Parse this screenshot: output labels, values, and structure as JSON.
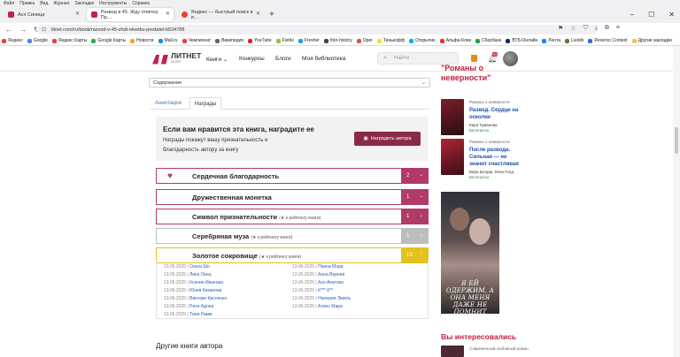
{
  "browser": {
    "menu": [
      "Файл",
      "Правка",
      "Вид",
      "Журнал",
      "Закладки",
      "Инструменты",
      "Справка"
    ],
    "tabs": [
      {
        "label": "Ася Синица",
        "active": false
      },
      {
        "label": "Развод в 45. Жду ответку. Пр…",
        "active": true
      },
      {
        "label": "Яндекс — быстрый поиск в и…",
        "active": false
      }
    ],
    "url": "litnet.com/ru/book/razvod-v-45-zhdi-otvetku-predatel-b534788",
    "bookmarks": [
      "Яндекс",
      "Google",
      "Яндекс Карты",
      "Google Карты",
      "Новости",
      "Mail.ru",
      "Чемпионат",
      "Википедия",
      "YouTube",
      "Fishki",
      "Fresher",
      "foto-history",
      "Oper",
      "Тинькофф",
      "Открытие",
      "Альфа-Клик",
      "Сбербанк",
      "ВТБ-Онлайн",
      "Лента",
      "Livelib",
      "Reverso Context",
      "Другие закладки"
    ]
  },
  "site": {
    "logo": "ЛИТНЕТ",
    "logo_sub": "10 ЛЕТ",
    "nav": [
      "Книги",
      "Конкурсы",
      "Блоги",
      "Моя библиотека"
    ],
    "search_placeholder": "Найти",
    "notifications": "99",
    "contents_select": "Содержание",
    "tabs": [
      "Аннотация",
      "Награды"
    ],
    "award_title": "Если вам нравится эта книга, наградите ее",
    "award_text": "Награды покажут вашу признательность и благодарность автору за книгу",
    "award_button": "Наградить автора",
    "rewards": [
      {
        "name": "Сердечная благодарность",
        "note": "",
        "count": "2",
        "color": "#b23a6a"
      },
      {
        "name": "Дружественная монетка",
        "note": "",
        "count": "1",
        "color": "#b23a6a"
      },
      {
        "name": "Символ признательности",
        "note": "(★ к рейтингу книги)",
        "count": "1",
        "color": "#b23a6a"
      },
      {
        "name": "Серебряная муза",
        "note": "(★ к рейтингу книги)",
        "count": "1",
        "color": "#bdbdbd"
      },
      {
        "name": "Золотое сокровище",
        "note": "(★ к рейтингу книги)",
        "count": "13",
        "color": "#e2c21f"
      }
    ],
    "gold_list_left": [
      {
        "date": "13.06.2025",
        "name": "Ольга Шо"
      },
      {
        "date": "13.06.2025",
        "name": "Лика Ланц"
      },
      {
        "date": "13.06.2025",
        "name": "Ксения Иванова"
      },
      {
        "date": "13.06.2025",
        "name": "Юлия Киканова"
      },
      {
        "date": "13.06.2025",
        "name": "Виктори Кисленко"
      },
      {
        "date": "13.06.2025",
        "name": "Рита Адлер"
      },
      {
        "date": "13.06.2025",
        "name": "Тина Рамм"
      }
    ],
    "gold_list_right": [
      {
        "date": "13.06.2025",
        "name": "Панна Мэра"
      },
      {
        "date": "13.06.2025",
        "name": "Анна Верная"
      },
      {
        "date": "13.06.2025",
        "name": "Ася Акатова"
      },
      {
        "date": "13.06.2025",
        "name": "К*** К**"
      },
      {
        "date": "13.06.2025",
        "name": "Налерия Эмиль"
      },
      {
        "date": "13.06.2025",
        "name": "Алекс Мара"
      }
    ],
    "other_books": "Другие книги автора"
  },
  "sidebar": {
    "heading_line1": "\"Романы о",
    "heading_line2": "неверности\"",
    "books": [
      {
        "genre": "Романы о неверности",
        "title": "Развод. Сердце на осколки",
        "author": "Кира Туманова",
        "price": "Бесплатно"
      },
      {
        "genre": "Романы о неверности",
        "title": "После развода. Сильная — не значит счастливая",
        "author": "Вера Шторм, Лена Голд",
        "price": "Бесплатно"
      }
    ],
    "ad_text": "Я ЕЙ ОДЕРЖИМ, А ОНА МЕНЯ ДАЖЕ НЕ ПОМНИТ",
    "interest_heading": "Вы интересовались",
    "interest_genre": "Современный любовный роман"
  },
  "colors": {
    "brand": "#c51f4a",
    "award_button": "#8b2a47",
    "link": "#2563b8"
  }
}
